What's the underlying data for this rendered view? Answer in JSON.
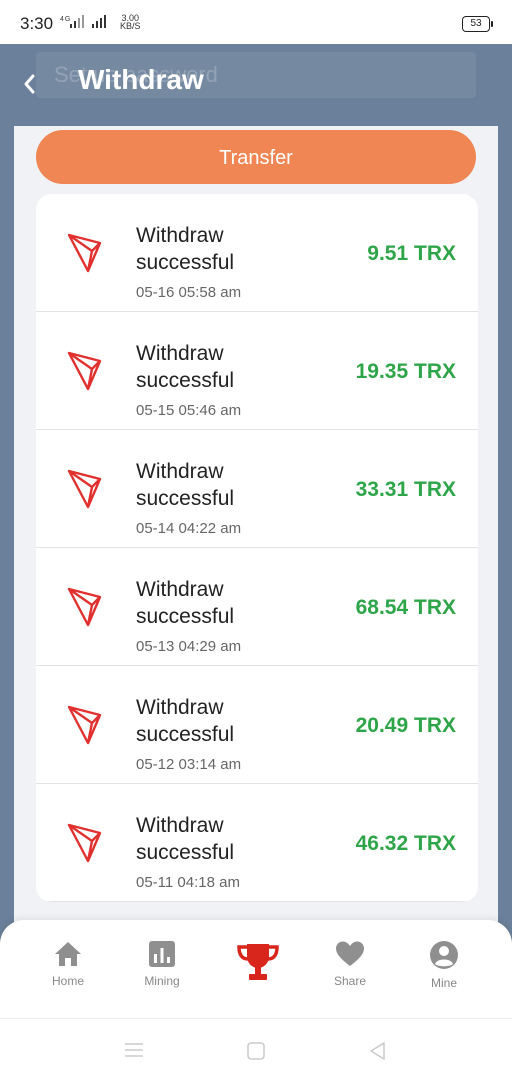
{
  "status_bar": {
    "time": "3:30",
    "network": "4G",
    "speed_value": "3.00",
    "speed_unit": "KB/S",
    "battery": "53"
  },
  "header": {
    "title": "Withdraw",
    "ghost_placeholder": "Set up password"
  },
  "transfer_button": {
    "label": "Transfer"
  },
  "withdrawals": [
    {
      "title": "Withdraw successful",
      "date": "05-16 05:58 am",
      "amount": "9.51 TRX"
    },
    {
      "title": "Withdraw successful",
      "date": "05-15 05:46 am",
      "amount": "19.35 TRX"
    },
    {
      "title": "Withdraw successful",
      "date": "05-14 04:22 am",
      "amount": "33.31 TRX"
    },
    {
      "title": "Withdraw successful",
      "date": "05-13 04:29 am",
      "amount": "68.54 TRX"
    },
    {
      "title": "Withdraw successful",
      "date": "05-12 03:14 am",
      "amount": "20.49 TRX"
    },
    {
      "title": "Withdraw successful",
      "date": "05-11 04:18 am",
      "amount": "46.32 TRX"
    }
  ],
  "bottom_nav": {
    "items": [
      {
        "label": "Home",
        "icon": "home-icon"
      },
      {
        "label": "Mining",
        "icon": "bar-chart-icon"
      },
      {
        "label": "",
        "icon": "trophy-icon",
        "active": true
      },
      {
        "label": "Share",
        "icon": "heart-icon"
      },
      {
        "label": "Mine",
        "icon": "user-icon"
      }
    ]
  },
  "colors": {
    "header_bg": "#6b809a",
    "accent_orange": "#ef8654",
    "amount_green": "#2fa54a",
    "tron_red": "#e0312f",
    "active_nav_red": "#d9261c"
  }
}
